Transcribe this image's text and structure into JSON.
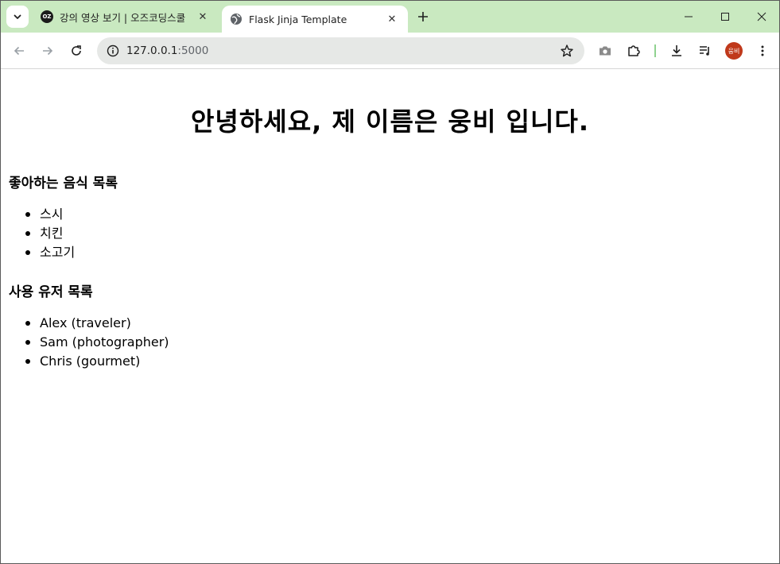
{
  "browser": {
    "tabs": [
      {
        "title": "강의 영상 보기 | 오즈코딩스쿨",
        "favicon": "OZ",
        "active": false
      },
      {
        "title": "Flask Jinja Template",
        "favicon": "globe-icon",
        "active": true
      }
    ],
    "tab_close_glyph": "✕",
    "address": {
      "host": "127.0.0.1",
      "port": ":5000"
    },
    "profile_initials": "웅비",
    "colors": {
      "tabstrip": "#c9e9c0",
      "omnibox": "#e6e8e6",
      "avatar": "#c0391b"
    }
  },
  "page": {
    "greeting": "안녕하세요, 제 이름은 웅비 입니다.",
    "foods_title": "좋아하는 음식 목록",
    "foods": [
      "스시",
      "치킨",
      "소고기"
    ],
    "users_title": "사용 유저 목록",
    "users": [
      "Alex (traveler)",
      "Sam (photographer)",
      "Chris (gourmet)"
    ]
  }
}
